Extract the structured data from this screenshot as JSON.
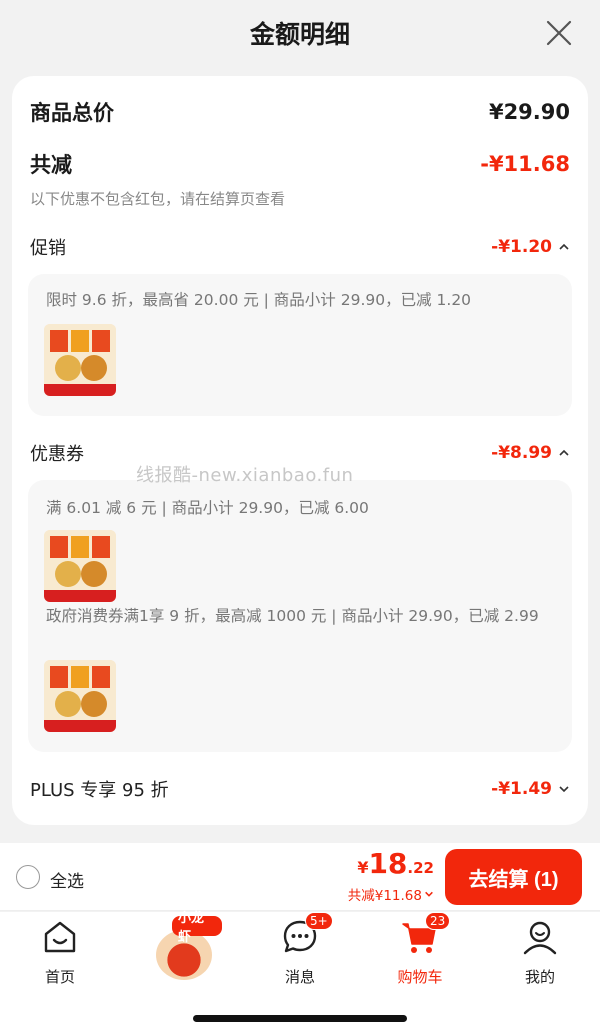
{
  "sheet": {
    "title": "金额明细"
  },
  "summary": {
    "total_label": "商品总价",
    "total_value": "¥29.90",
    "reduce_label": "共减",
    "reduce_value": "-¥11.68",
    "note": "以下优惠不包含红包，请在结算页查看"
  },
  "promotion": {
    "label": "促销",
    "value": "-¥1.20",
    "detail": "限时 9.6 折，最高省 20.00 元 | 商品小计 29.90，已减 1.20"
  },
  "coupon": {
    "label": "优惠券",
    "value": "-¥8.99",
    "items": [
      {
        "detail": "满 6.01 减 6 元 | 商品小计 29.90，已减 6.00"
      },
      {
        "detail": "政府消费券满1享 9 折，最高减 1000 元 | 商品小计 29.90，已减 2.99"
      }
    ]
  },
  "plus": {
    "label": "PLUS 专享 95 折",
    "value": "-¥1.49"
  },
  "watermark": "线报酷-new.xianbao.fun",
  "checkout": {
    "select_all": "全选",
    "currency": "¥",
    "total_int": "18",
    "total_dec": ".22",
    "discount_text": "共减¥11.68",
    "button_label": "去结算 (1)"
  },
  "tabbar": {
    "home": "首页",
    "promo_badge": "小龙虾",
    "messages": "消息",
    "messages_badge": "5+",
    "cart": "购物车",
    "cart_badge": "23",
    "mine": "我的"
  },
  "colors": {
    "accent": "#f2270c",
    "background": "#f2f2f2",
    "card": "#ffffff"
  }
}
